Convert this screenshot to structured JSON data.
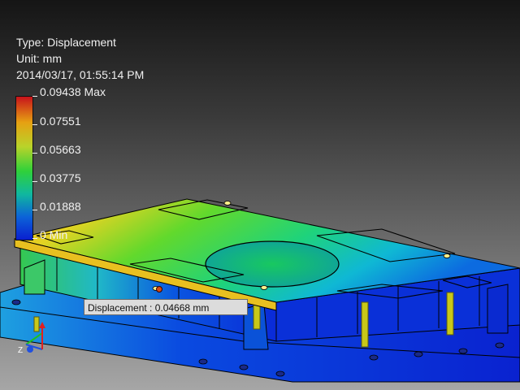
{
  "result_info": {
    "type_line": "Type: Displacement",
    "unit_line": "Unit: mm",
    "timestamp": "2014/03/17, 01:55:14 PM"
  },
  "legend": {
    "max_label": "0.09438 Max",
    "ticks": [
      "0.07551",
      "0.05663",
      "0.03775",
      "0.01888"
    ],
    "min_label": "0 Min",
    "colors": [
      "#c8121b",
      "#e6a112",
      "#b9d32a",
      "#2fd13a",
      "#10b89e",
      "#0c63d8",
      "#0a1fd0"
    ]
  },
  "probe": {
    "label": "Displacement : 0.04668 mm",
    "value": 0.04668
  },
  "view_triad": {
    "icon": "xyz-axis-triad-icon",
    "z_label": "Z"
  }
}
